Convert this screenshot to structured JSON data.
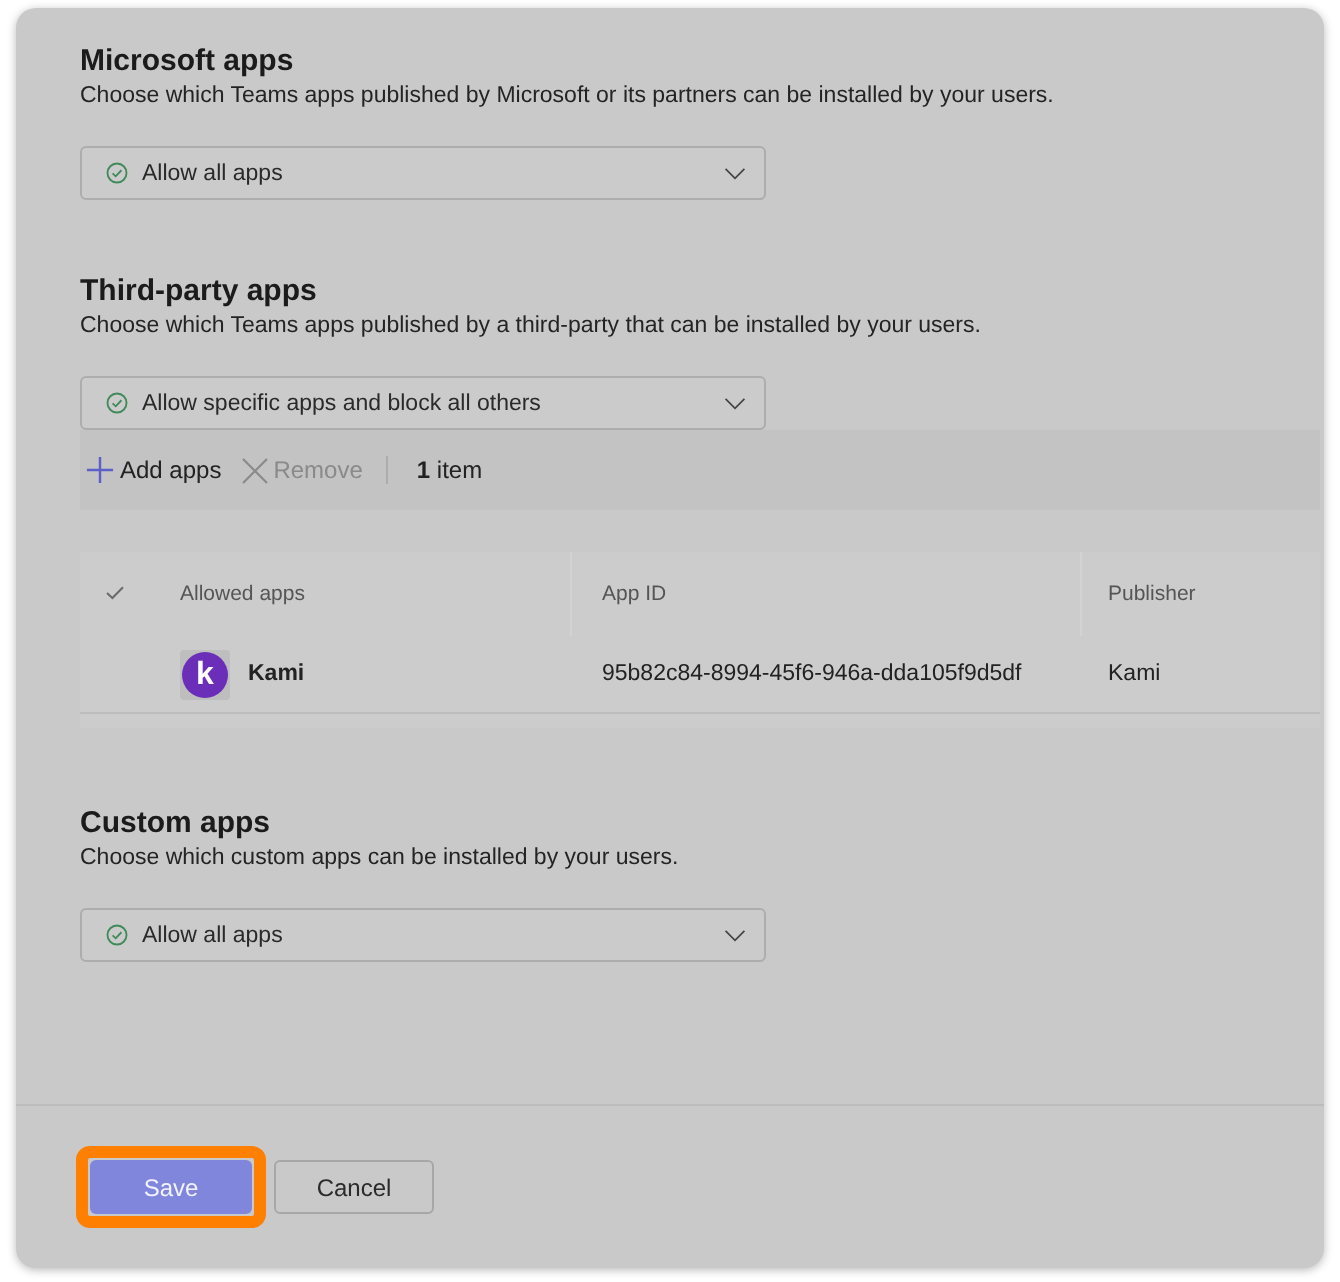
{
  "sections": [
    {
      "title": "Microsoft apps",
      "description": "Choose which Teams apps published by Microsoft or its partners can be installed by your users.",
      "dropdown": {
        "value": "Allow all apps"
      }
    },
    {
      "title": "Third-party apps",
      "description": "Choose which Teams apps published by a third-party that can be installed by your users.",
      "dropdown": {
        "value": "Allow specific apps and block all others"
      },
      "toolbar": {
        "actions": [
          {
            "kind": "add",
            "label": "Add apps",
            "disabled": false
          },
          {
            "kind": "remove",
            "label": "Remove",
            "disabled": true
          }
        ],
        "count": "**1** item"
      },
      "table": {
        "columns": [
          "Allowed apps",
          "App ID",
          "Publisher"
        ],
        "rows": [
          {
            "selected": false,
            "logo_text": "k",
            "cells": [
              "Kami",
              "95b82c84-8994-45f6-946a-dda105f9d5df",
              "Kami"
            ]
          }
        ]
      }
    },
    {
      "title": "Custom apps",
      "description": "Choose which custom apps can be installed by your users.",
      "dropdown": {
        "value": "Allow all apps"
      }
    }
  ],
  "footer": {
    "buttons": [
      {
        "kind": "primary",
        "label": "Save",
        "highlighted": true
      },
      {
        "kind": "secondary",
        "label": "Cancel",
        "highlighted": false
      }
    ]
  }
}
